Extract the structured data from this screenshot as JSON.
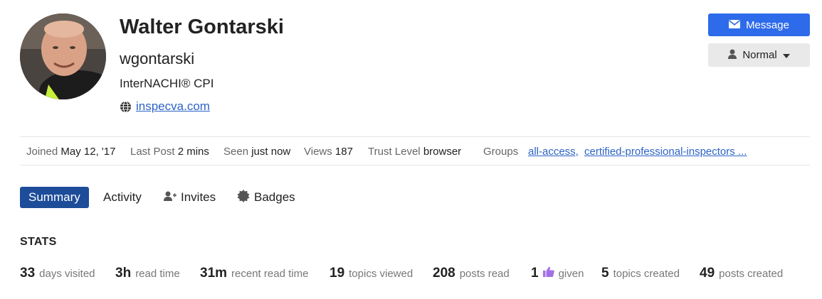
{
  "profile": {
    "name": "Walter Gontarski",
    "username": "wgontarski",
    "title": "InterNACHI® CPI",
    "website": "inspecva.com"
  },
  "actions": {
    "message_label": "Message",
    "notification_label": "Normal"
  },
  "meta": {
    "joined_label": "Joined",
    "joined_value": "May 12, '17",
    "last_post_label": "Last Post",
    "last_post_value": "2 mins",
    "seen_label": "Seen",
    "seen_value": "just now",
    "views_label": "Views",
    "views_value": "187",
    "trust_label": "Trust Level",
    "trust_value": "browser",
    "groups_label": "Groups",
    "groups": [
      "all-access,",
      "certified-professional-inspectors ..."
    ]
  },
  "tabs": [
    {
      "label": "Summary",
      "active": true
    },
    {
      "label": "Activity"
    },
    {
      "label": "Invites"
    },
    {
      "label": "Badges"
    }
  ],
  "stats": {
    "heading": "STATS",
    "items": [
      {
        "value": "33",
        "label": "days visited"
      },
      {
        "value": "3h",
        "label": "read time"
      },
      {
        "value": "31m",
        "label": "recent read time"
      },
      {
        "value": "19",
        "label": "topics viewed"
      },
      {
        "value": "208",
        "label": "posts read"
      },
      {
        "value": "1",
        "label": "given",
        "icon": "thumbs-up-icon"
      },
      {
        "value": "5",
        "label": "topics created"
      },
      {
        "value": "49",
        "label": "posts created"
      }
    ]
  },
  "colors": {
    "primary": "#2d6bea",
    "tab_active": "#1d4c99",
    "link": "#2c63c7",
    "like": "#a371e6"
  }
}
